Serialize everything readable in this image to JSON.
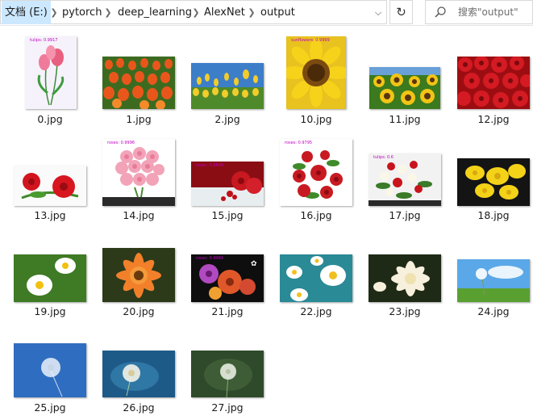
{
  "breadcrumb": [
    "文档 (E:)",
    "pytorch",
    "deep_learning",
    "AlexNet",
    "output"
  ],
  "icons": {
    "separator": "chevron-right-icon",
    "history": "chevron-down-icon",
    "refresh": "refresh-icon",
    "search": "search-icon"
  },
  "search": {
    "placeholder": "搜索\"output\""
  },
  "files": [
    {
      "name": "0.jpg",
      "label": "tulips: 0.9917"
    },
    {
      "name": "1.jpg",
      "label": ""
    },
    {
      "name": "2.jpg",
      "label": ""
    },
    {
      "name": "10.jpg",
      "label": "sunflowers: 0.9999"
    },
    {
      "name": "11.jpg",
      "label": ""
    },
    {
      "name": "12.jpg",
      "label": ""
    },
    {
      "name": "13.jpg",
      "label": ""
    },
    {
      "name": "14.jpg",
      "label": "roses: 0.9996"
    },
    {
      "name": "15.jpg",
      "label": "roses: 0.9848"
    },
    {
      "name": "16.jpg",
      "label": "roses: 0.9795"
    },
    {
      "name": "17.jpg",
      "label": "tulips: 0.6"
    },
    {
      "name": "18.jpg",
      "label": ""
    },
    {
      "name": "19.jpg",
      "label": ""
    },
    {
      "name": "20.jpg",
      "label": ""
    },
    {
      "name": "21.jpg",
      "label": "roses: 0.9984"
    },
    {
      "name": "22.jpg",
      "label": ""
    },
    {
      "name": "23.jpg",
      "label": ""
    },
    {
      "name": "24.jpg",
      "label": ""
    },
    {
      "name": "25.jpg",
      "label": ""
    },
    {
      "name": "26.jpg",
      "label": ""
    },
    {
      "name": "27.jpg",
      "label": ""
    }
  ]
}
